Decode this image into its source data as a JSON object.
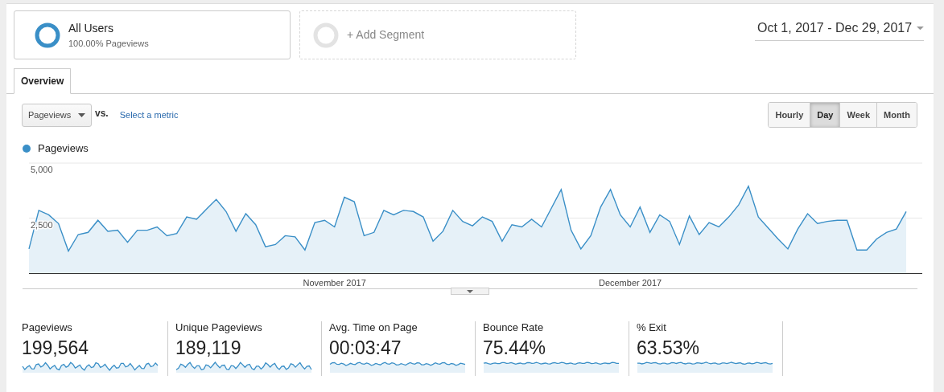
{
  "segments": [
    {
      "kind": "active",
      "title": "All Users",
      "subtitle": "100.00% Pageviews"
    },
    {
      "kind": "add",
      "title": "+ Add Segment"
    }
  ],
  "date_range": "Oct 1, 2017 - Dec 29, 2017",
  "tabs": [
    {
      "label": "Overview",
      "selected": true
    }
  ],
  "metric_select": "Pageviews",
  "vs_label": "vs.",
  "compare_link": "Select a metric",
  "intervals": [
    {
      "label": "Hourly",
      "selected": false
    },
    {
      "label": "Day",
      "selected": true
    },
    {
      "label": "Week",
      "selected": false
    },
    {
      "label": "Month",
      "selected": false
    }
  ],
  "chart": {
    "month_labels": [
      "November 2017",
      "December 2017"
    ],
    "chart_data": {
      "type": "area",
      "ylim": [
        0,
        5000
      ],
      "yticks": [
        {
          "value": 2500,
          "label": "2,500"
        },
        {
          "value": 5000,
          "label": "5,000"
        }
      ],
      "series": [
        {
          "name": "Pageviews",
          "color": "#3a8fc7",
          "values": [
            1100,
            2850,
            2650,
            2250,
            1000,
            1750,
            1850,
            2400,
            1900,
            1950,
            1400,
            1950,
            1950,
            2100,
            1700,
            1800,
            2550,
            2450,
            2900,
            3350,
            2800,
            1900,
            2700,
            2200,
            1200,
            1300,
            1700,
            1650,
            1050,
            2300,
            2400,
            2100,
            3450,
            3250,
            1700,
            1850,
            2850,
            2650,
            2850,
            2800,
            2550,
            1450,
            1900,
            2850,
            2350,
            2150,
            2550,
            2350,
            1450,
            2200,
            2100,
            2450,
            2100,
            2950,
            3800,
            1950,
            1100,
            1700,
            3000,
            3800,
            2650,
            2100,
            3000,
            1850,
            2650,
            2350,
            1300,
            2600,
            1750,
            2300,
            2100,
            2550,
            3100,
            3950,
            2550,
            2050,
            1550,
            1100,
            2000,
            2700,
            2250,
            2350,
            2400,
            2400,
            1050,
            1050,
            1550,
            1850,
            2000,
            2800
          ]
        }
      ]
    }
  },
  "metrics": [
    {
      "label": "Pageviews",
      "value": "199,564"
    },
    {
      "label": "Unique Pageviews",
      "value": "189,119"
    },
    {
      "label": "Avg. Time on Page",
      "value": "00:03:47"
    },
    {
      "label": "Bounce Rate",
      "value": "75.44%"
    },
    {
      "label": "% Exit",
      "value": "63.53%"
    }
  ]
}
